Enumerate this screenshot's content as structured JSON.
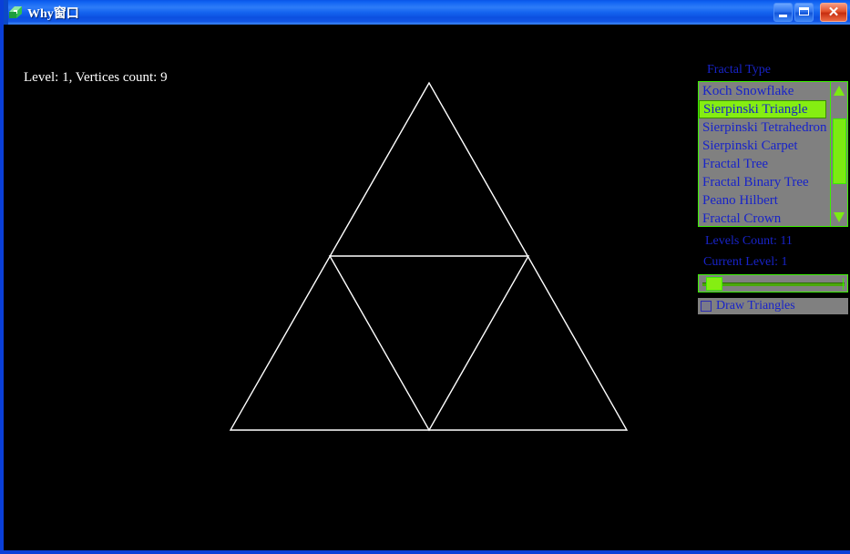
{
  "window": {
    "title": "Why窗口",
    "icon": "app-icon",
    "controls": {
      "minimize": "–",
      "maximize": "□",
      "close": "✕"
    }
  },
  "canvas": {
    "status": "Level: 1, Vertices count: 9",
    "background": "#000000",
    "stroke": "#ffffff",
    "fractal": {
      "name": "Sierpinski Triangle",
      "level": 1,
      "vertices_count": 9,
      "outer": {
        "apex": [
          467,
          64
        ],
        "left": [
          249,
          445
        ],
        "right": [
          684,
          445
        ]
      }
    }
  },
  "panel": {
    "fractal_type_label": "Fractal Type",
    "list": {
      "items": [
        "Koch Snowflake",
        "Sierpinski Triangle",
        "Sierpinski Tetrahedron",
        "Sierpinski Carpet",
        "Fractal Tree",
        "Fractal Binary Tree",
        "Peano Hilbert",
        "Fractal Crown"
      ],
      "selected_index": 1,
      "selected_value": "Sierpinski Triangle",
      "background": "#808080",
      "border_color": "#3cf000",
      "selection_color": "#85ee12",
      "text_color": "#1823c8"
    },
    "scrollbar": {
      "up_arrow": "▲",
      "down_arrow": "▼",
      "thumb_color": "#7ceb12"
    },
    "levels_count_label": "Levels Count: 11",
    "current_level_label": "Current Level: 1",
    "slider": {
      "value": 1,
      "min": 0,
      "max": 11,
      "thumb_color": "#85ee12"
    },
    "draw_triangles": {
      "label": "Draw Triangles",
      "checked": false
    }
  }
}
